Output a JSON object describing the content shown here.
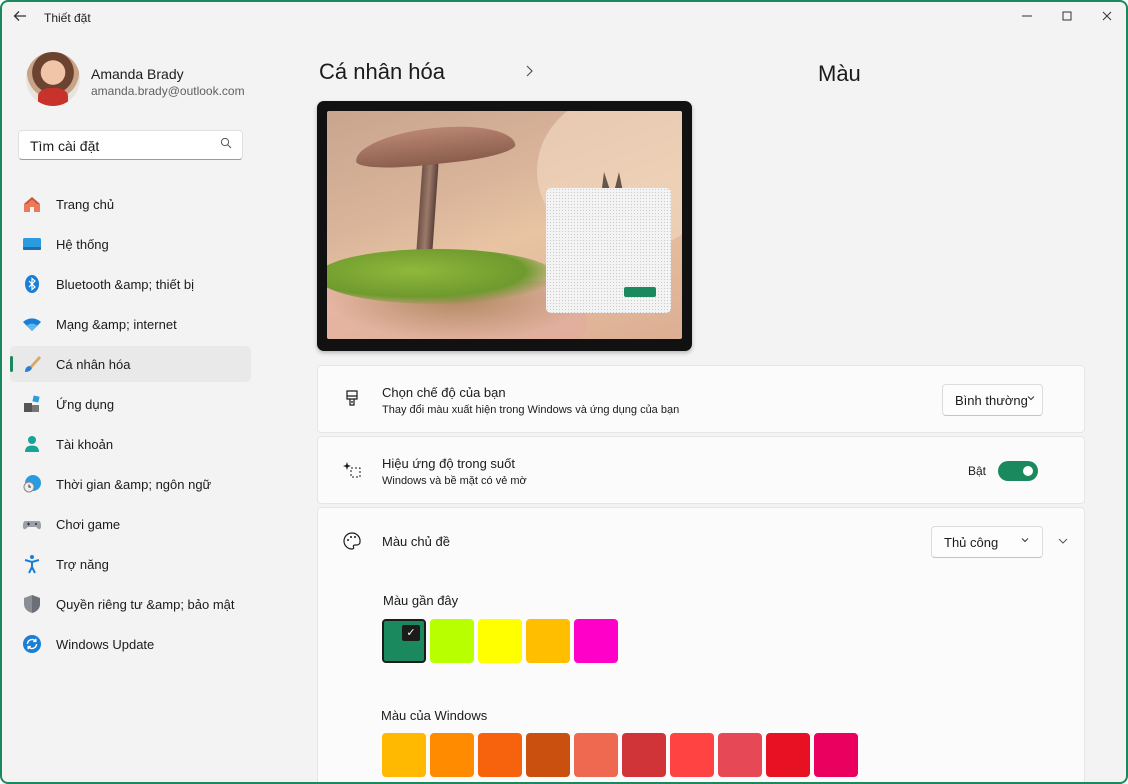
{
  "window": {
    "title": "Thiết đặt"
  },
  "profile": {
    "name": "Amanda Brady",
    "email": "amanda.brady@outlook.com"
  },
  "search": {
    "placeholder": "Tìm cài đặt"
  },
  "nav": [
    {
      "label": "Trang chủ",
      "icon": "home-icon"
    },
    {
      "label": "Hệ thống",
      "icon": "system-icon"
    },
    {
      "label": "Bluetooth &amp; thiết bị",
      "icon": "bluetooth-icon"
    },
    {
      "label": "Mạng &amp; internet",
      "icon": "wifi-icon"
    },
    {
      "label": "Cá nhân hóa",
      "icon": "brush-icon",
      "active": true
    },
    {
      "label": "Ứng dụng",
      "icon": "apps-icon"
    },
    {
      "label": "Tài khoản",
      "icon": "account-icon"
    },
    {
      "label": "Thời gian &amp; ngôn ngữ",
      "icon": "time-language-icon"
    },
    {
      "label": "Chơi game",
      "icon": "gamepad-icon"
    },
    {
      "label": "Trợ năng",
      "icon": "accessibility-icon"
    },
    {
      "label": "Quyền riêng tư &amp; bảo mật",
      "icon": "shield-icon"
    },
    {
      "label": "Windows Update",
      "icon": "update-icon"
    }
  ],
  "breadcrumb": {
    "parent": "Cá nhân hóa",
    "current": "Màu"
  },
  "mode": {
    "title": "Chọn chế độ của bạn",
    "description": "Thay đổi màu xuất hiện trong Windows và ứng dụng của bạn",
    "value": "Bình thường"
  },
  "transparency": {
    "title": "Hiệu ứng độ trong suốt",
    "description": "Windows và bề mặt có vẻ mờ",
    "state_label": "Bật",
    "on": true
  },
  "accent": {
    "title": "Màu chủ đề",
    "value": "Thủ công",
    "recent_label": "Màu gần đây",
    "recent_colors": [
      "#1a8a5e",
      "#b8ff00",
      "#ffff00",
      "#ffbe00",
      "#ff00c8"
    ],
    "windows_label": "Màu của Windows",
    "windows_colors": [
      "#ffb900",
      "#ff8c00",
      "#f7630c",
      "#ca5010",
      "#ef6950",
      "#d13438",
      "#ff4343",
      "#e74856",
      "#e81123",
      "#ea005e"
    ]
  }
}
